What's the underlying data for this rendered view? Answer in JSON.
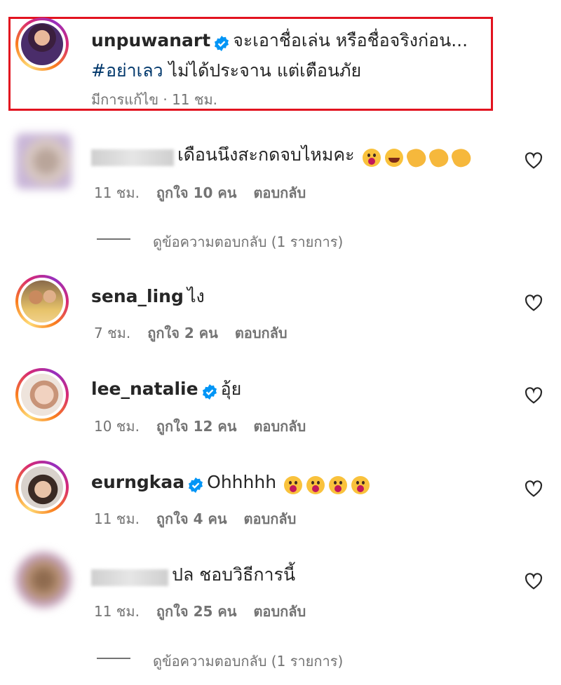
{
  "post": {
    "username": "unpuwanart",
    "verified": true,
    "caption_line1": "จะเอาชื่อเล่น หรือชื่อจริงก่อน...",
    "hashtag": "#อย่าเลว",
    "caption_line2": " ไม่ได้ประจาน แต่เตือนภัย",
    "meta": "มีการแก้ไข · 11 ชม."
  },
  "comments": [
    {
      "username": "",
      "text": "เดือนนึงสะกดจบไหมคะ",
      "emojis": [
        "wow",
        "laugh",
        "clap",
        "clap",
        "clap"
      ],
      "time": "11 ชม.",
      "likes": "ถูกใจ 10 คน",
      "reply": "ตอบกลับ",
      "view_replies": "ดูข้อความตอบกลับ (1 รายการ)"
    },
    {
      "username": "sena_ling",
      "text": "ไง",
      "time": "7 ชม.",
      "likes": "ถูกใจ 2 คน",
      "reply": "ตอบกลับ"
    },
    {
      "username": "lee_natalie",
      "verified": true,
      "text": "อุ้ย",
      "time": "10 ชม.",
      "likes": "ถูกใจ 12 คน",
      "reply": "ตอบกลับ"
    },
    {
      "username": "eurngkaa",
      "verified": true,
      "text": "Ohhhhh",
      "emojis": [
        "wow",
        "wow",
        "wow",
        "wow"
      ],
      "time": "11 ชม.",
      "likes": "ถูกใจ 4 คน",
      "reply": "ตอบกลับ"
    },
    {
      "username": "",
      "text": "ปล ชอบวิธีการนี้",
      "time": "11 ชม.",
      "likes": "ถูกใจ 25 คน",
      "reply": "ตอบกลับ",
      "view_replies": "ดูข้อความตอบกลับ (1 รายการ)"
    }
  ],
  "colors": {
    "text": "#262626",
    "secondary": "#737373",
    "verified": "#0095f6",
    "highlight": "#e2131f"
  }
}
